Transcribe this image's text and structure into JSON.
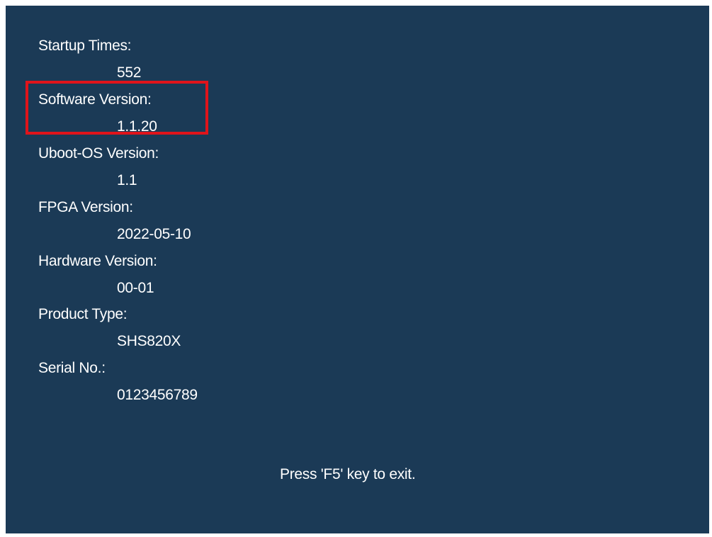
{
  "info": {
    "items": [
      {
        "label": "Startup Times:",
        "value": "552"
      },
      {
        "label": "Software Version:",
        "value": "1.1.20"
      },
      {
        "label": "Uboot-OS Version:",
        "value": "1.1"
      },
      {
        "label": "FPGA Version:",
        "value": "2022-05-10"
      },
      {
        "label": "Hardware Version:",
        "value": "00-01"
      },
      {
        "label": "Product Type:",
        "value": "SHS820X"
      },
      {
        "label": "Serial No.:",
        "value": "0123456789"
      }
    ]
  },
  "footer": {
    "hint": "Press 'F5' key to exit."
  },
  "colors": {
    "background": "#1b3a56",
    "text": "#ffffff",
    "highlight_border": "#e0141b"
  },
  "highlight": {
    "item": "Software Version:"
  }
}
